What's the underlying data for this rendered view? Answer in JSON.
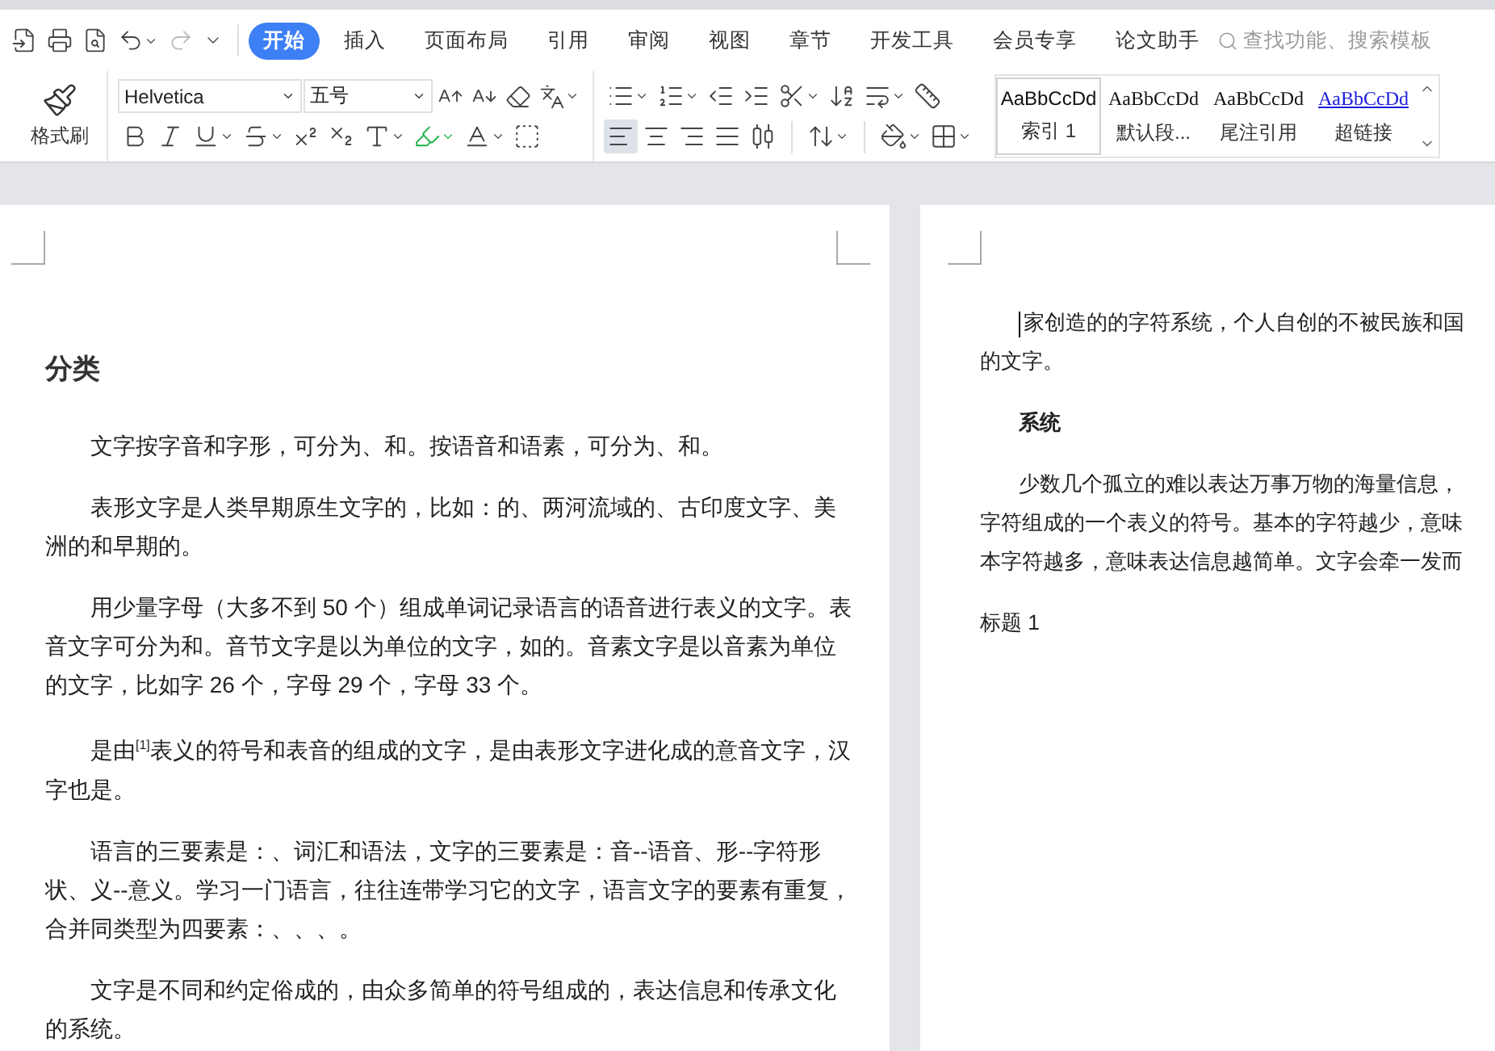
{
  "menu_tabs": [
    {
      "label": "开始",
      "selected": true
    },
    {
      "label": "插入",
      "selected": false
    },
    {
      "label": "页面布局",
      "selected": false
    },
    {
      "label": "引用",
      "selected": false
    },
    {
      "label": "审阅",
      "selected": false
    },
    {
      "label": "视图",
      "selected": false
    },
    {
      "label": "章节",
      "selected": false
    },
    {
      "label": "开发工具",
      "selected": false
    },
    {
      "label": "会员专享",
      "selected": false
    },
    {
      "label": "论文助手",
      "selected": false
    }
  ],
  "search": {
    "placeholder": "查找功能、搜索模板"
  },
  "toolbar": {
    "format_painter": "格式刷",
    "font_name": "Helvetica",
    "font_size": "五号",
    "alignment": [
      {
        "kind": "left",
        "selected": true
      },
      {
        "kind": "center",
        "selected": false
      },
      {
        "kind": "right",
        "selected": false
      },
      {
        "kind": "justify",
        "selected": false
      },
      {
        "kind": "distribute",
        "selected": false
      }
    ]
  },
  "styles": [
    {
      "preview": "AaBbCcDd",
      "label": "索引 1",
      "kind": "plain",
      "selected": true
    },
    {
      "preview": "AaBbCcDd",
      "label": "默认段...",
      "kind": "serif",
      "selected": false
    },
    {
      "preview": "AaBbCcDd",
      "label": "尾注引用",
      "kind": "serif",
      "selected": false
    },
    {
      "preview": "AaBbCcDd",
      "label": "超链接",
      "kind": "link",
      "selected": false
    }
  ],
  "left_page": {
    "heading": "分类",
    "paragraphs": [
      "文字按字音和字形，可分为、和。按语音和语素，可分为、和。",
      "表形文字是人类早期原生文字的，比如：的、两河流域的、古印度文字、美洲的和早期的。",
      "用少量字母（大多不到 50 个）组成单词记录语言的语音进行表义的文字。表音文字可分为和。音节文字是以为单位的文字，如的。音素文字是以音素为单位的文字，比如字 26 个，字母 29 个，字母 33 个。",
      "是由$^{[1]}$表义的符号和表音的组成的文字，是由表形文字进化成的意音文字，汉字也是。",
      "语言的三要素是：、词汇和语法，文字的三要素是：音--语音、形--字符形状、义--意义。学习一门语言，往往连带学习它的文字，语言文字的要素有重复，合并同类型为四要素：、、、。",
      "文字是不同和约定俗成的，由众多简单的符号组成的，表达信息和传承文化的系统。"
    ]
  },
  "right_page": {
    "blocks": [
      {
        "kind": "paragraph",
        "lines": [
          "家创造的的字符系统，个人自创的不被民族和国",
          "的文字。"
        ]
      },
      {
        "kind": "heading",
        "lines": [
          "系统"
        ]
      },
      {
        "kind": "paragraph",
        "lines": [
          "少数几个孤立的难以表达万事万物的海量信息，",
          "字符组成的一个表义的符号。基本的字符越少，意味",
          "本字符越多，意味表达信息越简单。文字会牵一发而"
        ]
      },
      {
        "kind": "label",
        "lines": [
          "标题 1"
        ]
      }
    ]
  }
}
